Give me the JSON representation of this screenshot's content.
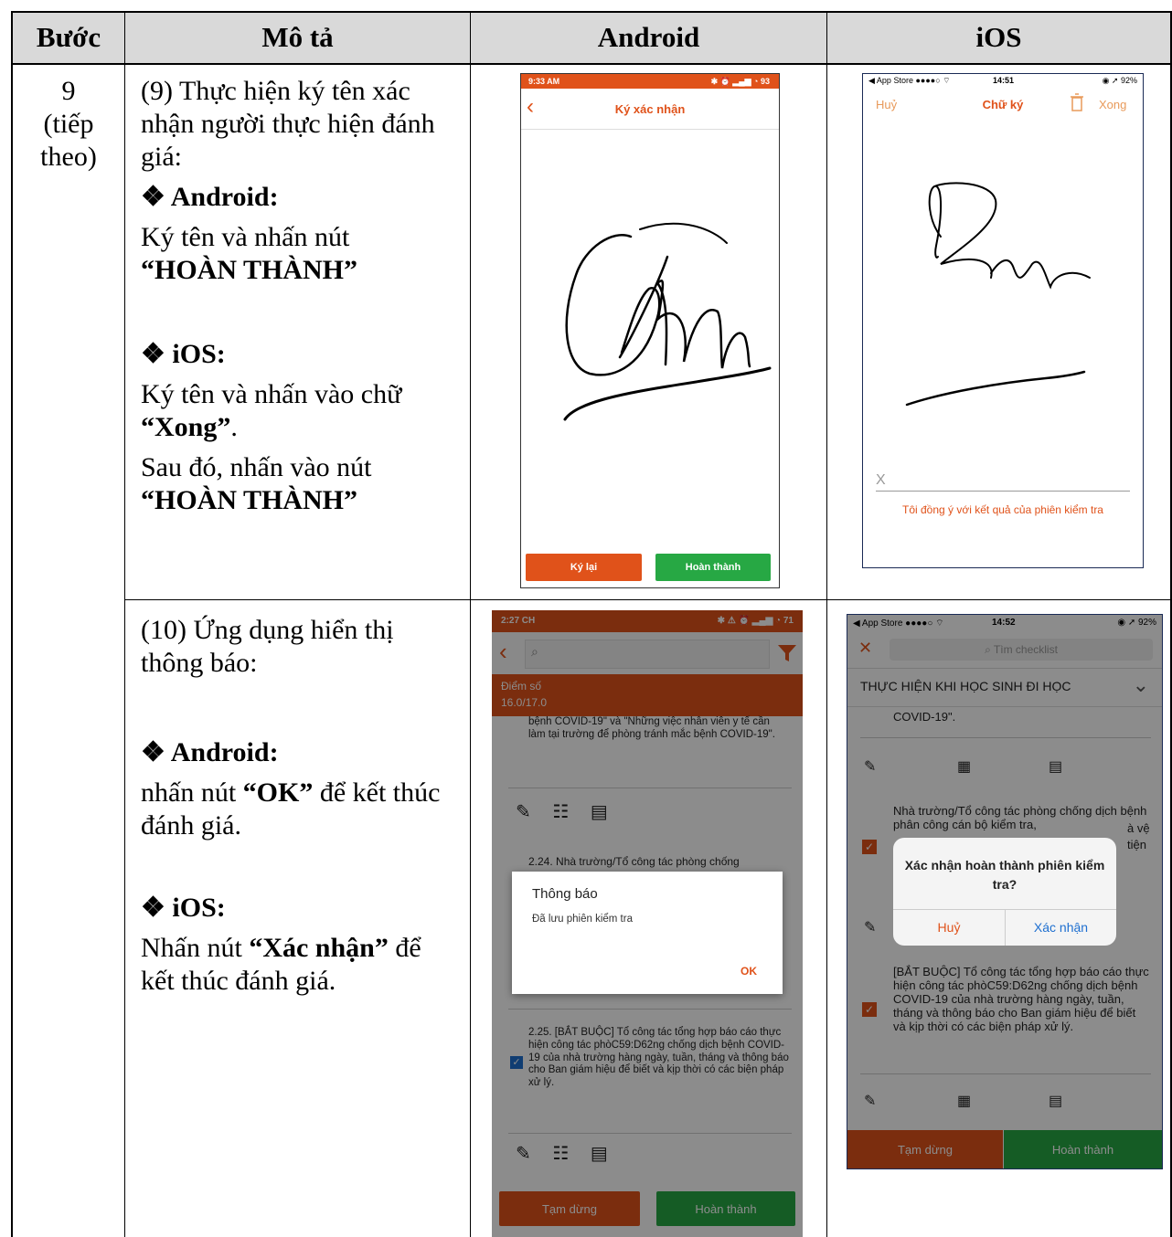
{
  "headers": {
    "step": "Bước",
    "desc": "Mô tả",
    "android": "Android",
    "ios": "iOS"
  },
  "row9": {
    "step_num": "9",
    "step_sub1": "(tiếp",
    "step_sub2": "theo)",
    "desc_intro": "(9) Thực hiện ký tên xác nhận người thực hiện đánh giá:",
    "android_head": "❖ Android:",
    "android_text": "Ký tên và nhấn nút",
    "android_bold": "“HOÀN THÀNH”",
    "ios_head": "❖ iOS:",
    "ios_text": "Ký tên và nhấn vào chữ",
    "ios_bold": "“Xong”",
    "ios_dot": ".",
    "after_text": "Sau đó, nhấn vào nút",
    "after_bold": "“HOÀN THÀNH”",
    "android_screen": {
      "time": "9:33 AM",
      "status": "✱ ⏰ ▂▄▆ ◔ 93",
      "title": "Ký xác nhận",
      "back": "‹",
      "btn_resign": "Ký lại",
      "btn_done": "Hoàn thành"
    },
    "ios_screen": {
      "carrier": "◀ App Store ●●●●○ ⌔",
      "time": "14:51",
      "battery": "◉ ➚ 92%",
      "cancel": "Huỷ",
      "title": "Chữ ký",
      "done": "Xong",
      "x_mark": "X",
      "agree": "Tôi đồng ý với kết quả của phiên kiểm tra"
    }
  },
  "row10": {
    "desc_intro": "(10) Ứng dụng hiển thị thông báo:",
    "android_head": "❖ Android:",
    "android_t1": "nhấn nút ",
    "android_bold": "“OK”",
    "android_t2": " để kết thúc đánh giá.",
    "ios_head": "❖ iOS:",
    "ios_t1": "Nhấn nút ",
    "ios_bold": "“Xác nhận”",
    "ios_t2": " để kết thúc đánh giá.",
    "android_screen": {
      "time": "2:27 CH",
      "status": "✱ ⚠ ⏰ ▂▄▆ ◔ 71",
      "search_icon": "⌕",
      "score_label": "Điểm số",
      "score_value": "16.0/17.0",
      "text_top": "bệnh COVID-19\" và \"Những việc nhân viên y tế cần làm tại trường để phòng tránh mắc bệnh COVID-19\".",
      "item24": "2.24. Nhà trường/Tổ công tác phòng chống",
      "item25": "2.25. [BẮT BUỘC] Tổ công tác tổng hợp báo cáo thực hiện công tác phòC59:D62ng chống dịch bệnh COVID-19 của nhà trường hàng ngày, tuần, tháng và thông báo cho Ban giám hiệu để biết và kịp thời có các biện pháp xử lý.",
      "dialog_title": "Thông báo",
      "dialog_msg": "Đã lưu phiên kiểm tra",
      "dialog_ok": "OK",
      "btn_pause": "Tạm dừng",
      "btn_done": "Hoàn thành"
    },
    "ios_screen": {
      "carrier": "◀ App Store ●●●●○ ⌔",
      "time": "14:52",
      "battery": "◉ ➚ 92%",
      "close": "✕",
      "search": "⌕ Tìm checklist",
      "section": "THỰC HIỆN KHI HỌC SINH ĐI HỌC",
      "chevron": "⌄",
      "text_top": "COVID-19\".",
      "item_a": "Nhà trường/Tổ công tác phòng chống dịch bệnh phân công cán bộ kiểm tra,",
      "item_a_r1": "à vệ",
      "item_a_r2": "tiện",
      "item_b": "[BẮT BUỘC] Tổ công tác tổng hợp báo cáo thực hiện công tác phòC59:D62ng chống dịch bệnh COVID-19 của nhà trường hàng ngày, tuần, tháng và thông báo cho Ban giám hiệu để biết và kịp thời có các biện pháp xử lý.",
      "alert_title": "Xác nhận hoàn thành phiên kiểm tra?",
      "alert_cancel": "Huỷ",
      "alert_confirm": "Xác nhận",
      "btn_pause": "Tạm dừng",
      "btn_done": "Hoàn thành"
    }
  }
}
